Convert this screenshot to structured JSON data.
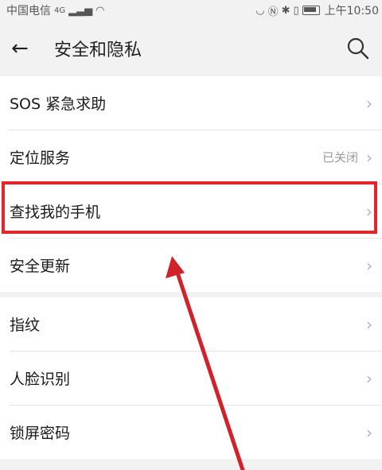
{
  "statusbar": {
    "carrier": "中国电信",
    "network": "4G",
    "time": "上午10:50"
  },
  "header": {
    "title": "安全和隐私"
  },
  "group1": [
    {
      "label": "SOS 紧急求助",
      "value": ""
    },
    {
      "label": "定位服务",
      "value": "已关闭"
    },
    {
      "label": "查找我的手机",
      "value": ""
    },
    {
      "label": "安全更新",
      "value": ""
    }
  ],
  "group2": [
    {
      "label": "指纹",
      "value": ""
    },
    {
      "label": "人脸识别",
      "value": ""
    },
    {
      "label": "锁屏密码",
      "value": ""
    }
  ],
  "chevron": "›",
  "colors": {
    "highlight": "#e2262b",
    "arrow": "#d0222a"
  }
}
